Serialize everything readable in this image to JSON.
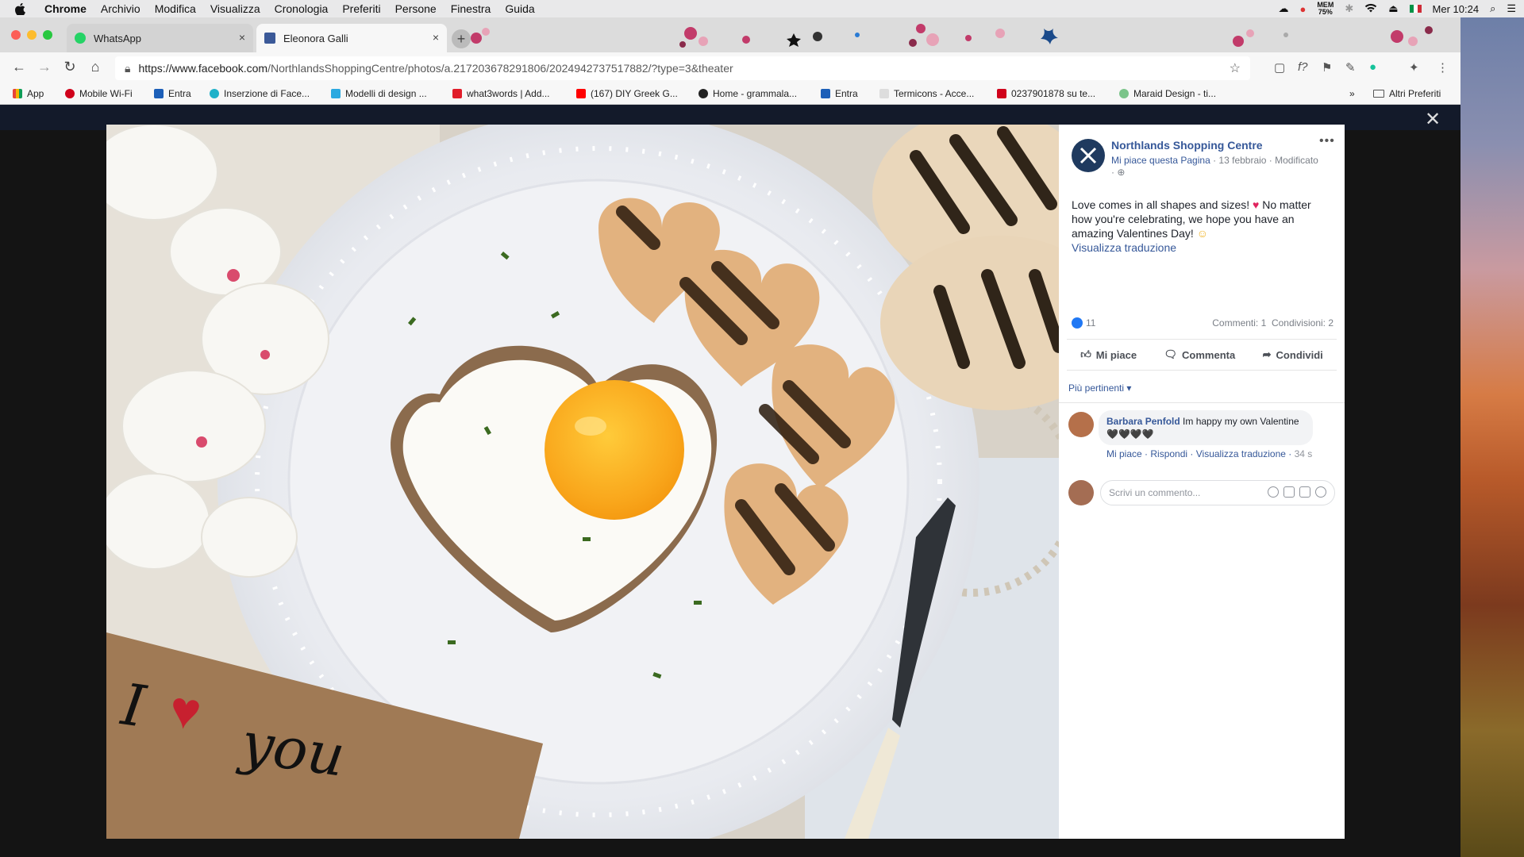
{
  "menubar": {
    "app": "Chrome",
    "items": [
      "Archivio",
      "Modifica",
      "Visualizza",
      "Cronologia",
      "Preferiti",
      "Persone",
      "Finestra",
      "Guida"
    ],
    "mem_label": "MEM",
    "mem_value": "75%",
    "clock": "Mer 10:24"
  },
  "tabs": [
    {
      "title": "WhatsApp",
      "close": "×"
    },
    {
      "title": "Eleonora Galli",
      "close": "×"
    }
  ],
  "newtab": "+",
  "address": {
    "domain": "https://www.facebook.com",
    "path": "/NorthlandsShoppingCentre/photos/a.217203678291806/2024942737517882/?type=3&theater"
  },
  "bookmarks": [
    {
      "label": "App",
      "color": "#e8443a"
    },
    {
      "label": "Mobile Wi-Fi",
      "color": "#d0021b"
    },
    {
      "label": "Entra",
      "color": "#1c5fb8"
    },
    {
      "label": "Inserzione di Face...",
      "color": "#1fb1c9"
    },
    {
      "label": "Modelli di design ...",
      "color": "#2ba9e0"
    },
    {
      "label": "what3words | Add...",
      "color": "#e11d2a"
    },
    {
      "label": "(167) DIY Greek G...",
      "color": "#ff0000"
    },
    {
      "label": "Home - grammala...",
      "color": "#222222"
    },
    {
      "label": "Entra",
      "color": "#1c5fb8"
    },
    {
      "label": "Termicons - Acce...",
      "color": "#666666"
    },
    {
      "label": "0237901878 su te...",
      "color": "#d0021b"
    },
    {
      "label": "Maraid Design - ti...",
      "color": "#7bc48a"
    }
  ],
  "bookmarks_more": "»",
  "other_bookmarks": "Altri Preferiti",
  "post": {
    "page_name": "Northlands Shopping Centre",
    "like_page": "Mi piace questa Pagina",
    "date": "13 febbraio",
    "edited": "Modificato",
    "text_1": "Love comes in all shapes and sizes!",
    "text_2": "No matter how you're celebrating, we hope you have an amazing Valentines Day!",
    "translate": "Visualizza traduzione",
    "likes": "11",
    "comments": "Commenti: 1",
    "shares": "Condivisioni: 2",
    "like_btn": "Mi piace",
    "comment_btn": "Comment­a",
    "share_btn": "Condividi",
    "filter": "Più pertinenti ▾"
  },
  "comment": {
    "author": "Barbara Penfold",
    "text": "Im happy my own Valentine 🖤🖤🖤🖤",
    "like": "Mi piace",
    "reply": "Rispondi",
    "translate": "Visualizza traduzione",
    "time": "34 s"
  },
  "composer": {
    "placeholder": "Scrivi un commento..."
  },
  "note_text": {
    "line1": "I",
    "line2": "you"
  },
  "colors": {
    "facebook_blue": "#365899",
    "like_blue": "#2078f4",
    "heart_red": "#e0245e"
  }
}
